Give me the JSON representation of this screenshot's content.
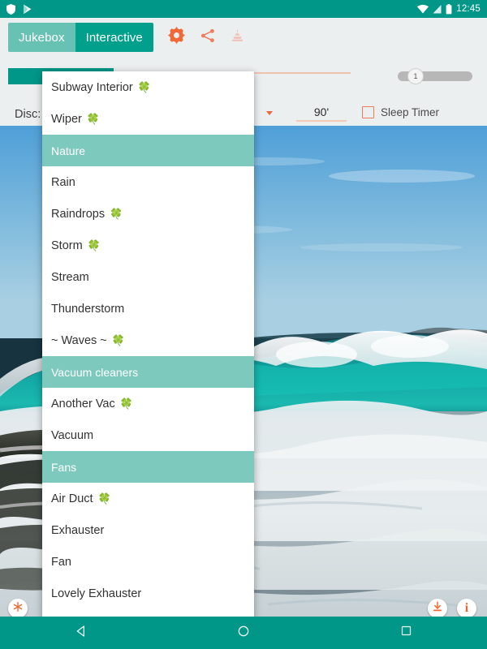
{
  "statusbar": {
    "time": "12:45",
    "left_icons": [
      {
        "name": "shield-icon"
      },
      {
        "name": "play-store-icon"
      }
    ],
    "right_icons": [
      {
        "name": "wifi-icon"
      },
      {
        "name": "cellular-signal-icon"
      },
      {
        "name": "battery-icon"
      }
    ]
  },
  "toolbar": {
    "tabs": [
      {
        "label": "Jukebox",
        "selected": false
      },
      {
        "label": "Interactive",
        "selected": true
      }
    ],
    "icons": [
      {
        "name": "settings-gear-icon",
        "color": "#ef6a36"
      },
      {
        "name": "share-icon",
        "color": "#ee7d5c"
      },
      {
        "name": "incense-burner-icon",
        "color": "#f0bfb5"
      }
    ]
  },
  "player": {
    "progress_percent": 31,
    "progress_fill_color": "#009688",
    "progress_track_color": "#f0c3ae",
    "volume": {
      "value": "1",
      "track_color": "#b7b7b7",
      "knob_position_percent": 18
    }
  },
  "disc_row": {
    "label": "Disc:",
    "dropdown_caret": "chevron-down-icon",
    "duration": "90'",
    "sleep_timer": {
      "label": "Sleep Timer",
      "checked": false,
      "accent_color": "#ef7a56"
    }
  },
  "dropdown": {
    "clover_glyph": "🍀",
    "header_bg": "#7ec9bd",
    "items": [
      {
        "label": "Subway Interior",
        "clover": true,
        "header": false
      },
      {
        "label": "Wiper",
        "clover": true,
        "header": false
      },
      {
        "label": "Nature",
        "clover": false,
        "header": true
      },
      {
        "label": "Rain",
        "clover": false,
        "header": false
      },
      {
        "label": "Raindrops",
        "clover": true,
        "header": false
      },
      {
        "label": "Storm",
        "clover": true,
        "header": false
      },
      {
        "label": "Stream",
        "clover": false,
        "header": false
      },
      {
        "label": "Thunderstorm",
        "clover": false,
        "header": false
      },
      {
        "label": "~ Waves ~",
        "clover": true,
        "header": false
      },
      {
        "label": "Vacuum cleaners",
        "clover": false,
        "header": true
      },
      {
        "label": "Another Vac",
        "clover": true,
        "header": false
      },
      {
        "label": "Vacuum",
        "clover": false,
        "header": false
      },
      {
        "label": "Fans",
        "clover": false,
        "header": true
      },
      {
        "label": "Air Duct",
        "clover": true,
        "header": false
      },
      {
        "label": "Exhauster",
        "clover": false,
        "header": false
      },
      {
        "label": "Fan",
        "clover": false,
        "header": false
      },
      {
        "label": "Lovely Exhauster",
        "clover": false,
        "header": false
      }
    ]
  },
  "floating_buttons": [
    {
      "name": "snowflake-icon",
      "color": "#ef6a36"
    },
    {
      "name": "download-icon",
      "color": "#ef6a36"
    },
    {
      "name": "info-icon",
      "color": "#e8683c",
      "glyph": "i"
    }
  ],
  "background": {
    "description": "ocean-waves-photo"
  },
  "navbar": {
    "background": "#009688",
    "buttons": [
      {
        "name": "nav-back-icon"
      },
      {
        "name": "nav-home-icon"
      },
      {
        "name": "nav-recents-icon"
      }
    ]
  }
}
